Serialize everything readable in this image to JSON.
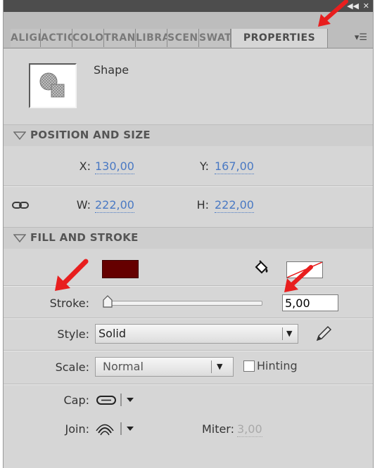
{
  "tabs": [
    {
      "label": "ALIGN"
    },
    {
      "label": "ACTIONS"
    },
    {
      "label": "COLOR"
    },
    {
      "label": "TRANSFORM"
    },
    {
      "label": "LIBRARY"
    },
    {
      "label": "SCENE"
    },
    {
      "label": "SWATCHES"
    },
    {
      "label": "PROPERTIES"
    }
  ],
  "titlebar": {
    "collapse_glyph": "◀◀",
    "close_glyph": "✕"
  },
  "menu_glyph": "▾☰",
  "instance": {
    "type_label": "Shape"
  },
  "position_size": {
    "title": "POSITION AND SIZE",
    "x_label": "X:",
    "x_value": "130,00",
    "y_label": "Y:",
    "y_value": "167,00",
    "w_label": "W:",
    "w_value": "222,00",
    "h_label": "H:",
    "h_value": "222,00"
  },
  "fill_stroke": {
    "title": "FILL AND STROKE",
    "stroke_color": "#650000",
    "fill_color": "none",
    "stroke_label": "Stroke:",
    "stroke_value": "5,00",
    "stroke_slider_fraction": 0.0,
    "style_label": "Style:",
    "style_value": "Solid",
    "scale_label": "Scale:",
    "scale_value": "Normal",
    "hinting_label": "Hinting",
    "hinting_checked": false,
    "cap_label": "Cap:",
    "join_label": "Join:",
    "miter_label": "Miter:",
    "miter_value": "3,00"
  },
  "icons": [
    "shape-thumbnail-icon",
    "link-icon",
    "paint-bucket-icon",
    "pencil-icon",
    "cap-round-icon",
    "join-round-icon"
  ],
  "accent_colors": {
    "link_value": "#4a79c3",
    "annotation_arrow": "#e81e1e"
  }
}
